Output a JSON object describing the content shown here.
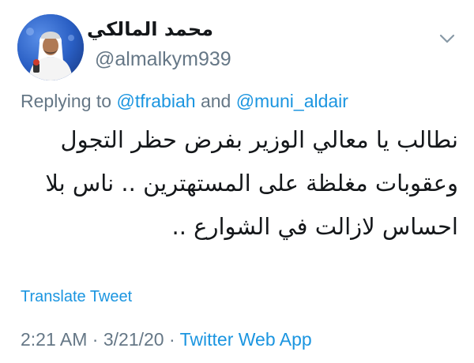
{
  "author": {
    "name": "محمد المالكي",
    "handle": "@almalkym939"
  },
  "reply": {
    "prefix": "Replying to",
    "mention1": "@tfrabiah",
    "joiner": "and",
    "mention2": "@muni_aldair"
  },
  "tweet": {
    "lines": [
      "نطالب يا معالي الوزير بفرض حظر التجول",
      "وعقوبات مغلظة على المستهترين .. ناس بلا",
      "احساس لازالت في الشوارع .."
    ]
  },
  "translate_label": "Translate Tweet",
  "meta": {
    "time": "2:21 AM",
    "separator": "·",
    "date": "3/21/20",
    "source": "Twitter Web App"
  },
  "colors": {
    "link": "#1b95e0",
    "secondary_text": "#657786",
    "primary_text": "#14171a"
  },
  "icons": {
    "caret": "chevron-down-icon",
    "avatar": "profile-photo"
  }
}
